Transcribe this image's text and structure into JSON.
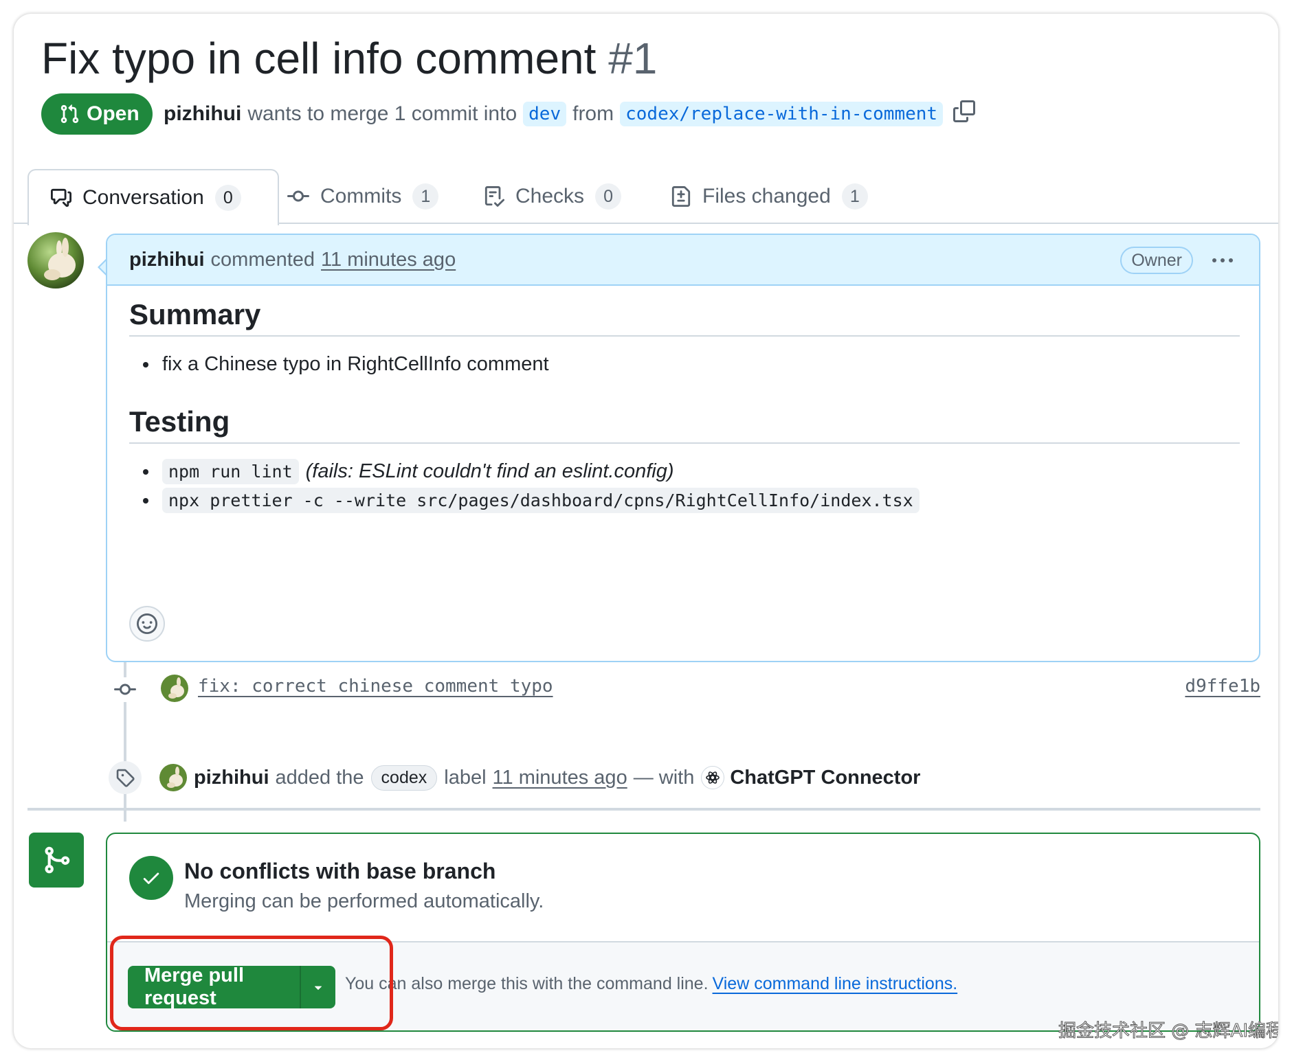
{
  "pr": {
    "title": "Fix typo in cell info comment",
    "number": "#1",
    "state": "Open",
    "author": "pizhihui",
    "merge_text": "wants to merge 1 commit into",
    "base_branch": "dev",
    "from_text": "from",
    "head_branch": "codex/replace-with-in-comment"
  },
  "tabs": [
    {
      "label": "Conversation",
      "count": "0",
      "icon": "comment-discussion-icon"
    },
    {
      "label": "Commits",
      "count": "1",
      "icon": "git-commit-icon"
    },
    {
      "label": "Checks",
      "count": "0",
      "icon": "checklist-icon"
    },
    {
      "label": "Files changed",
      "count": "1",
      "icon": "file-diff-icon"
    }
  ],
  "comment": {
    "author": "pizhihui",
    "action": "commented",
    "time": "11 minutes ago",
    "role_badge": "Owner",
    "summary_heading": "Summary",
    "summary_items": [
      "fix a Chinese typo in RightCellInfo comment"
    ],
    "testing_heading": "Testing",
    "testing_items": [
      {
        "code": "npm run lint",
        "note": "(fails: ESLint couldn't find an eslint.config)"
      },
      {
        "code": "npx prettier -c --write src/pages/dashboard/cpns/RightCellInfo/index.tsx",
        "note": ""
      }
    ]
  },
  "timeline": {
    "commit_message": "fix: correct chinese comment typo",
    "commit_sha": "d9ffe1b",
    "label_event": {
      "author": "pizhihui",
      "pre": "added the",
      "label": "codex",
      "post": "label",
      "time": "11 minutes ago",
      "with": "— with",
      "connector": "ChatGPT Connector"
    }
  },
  "merge": {
    "title": "No conflicts with base branch",
    "subtitle": "Merging can be performed automatically.",
    "button": "Merge pull request",
    "hint": "You can also merge this with the command line.",
    "link": "View command line instructions."
  },
  "watermark": "掘金技术社区 @ 志辉AI编程",
  "colors": {
    "green": "#1f883d",
    "blue_link": "#0969da",
    "comment_header_bg": "#ddf4ff",
    "highlight_red": "#e0271a"
  }
}
